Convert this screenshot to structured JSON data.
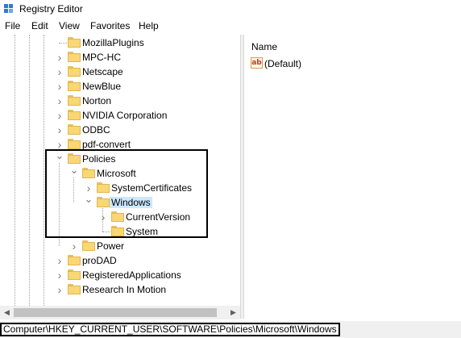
{
  "window": {
    "title": "Registry Editor"
  },
  "menu": [
    "File",
    "Edit",
    "View",
    "Favorites",
    "Help"
  ],
  "tree": {
    "nodes": [
      {
        "label": "MozillaPlugins",
        "expander": "none"
      },
      {
        "label": "MPC-HC",
        "expander": "collapsed"
      },
      {
        "label": "Netscape",
        "expander": "collapsed"
      },
      {
        "label": "NewBlue",
        "expander": "collapsed"
      },
      {
        "label": "Norton",
        "expander": "collapsed"
      },
      {
        "label": "NVIDIA Corporation",
        "expander": "collapsed"
      },
      {
        "label": "ODBC",
        "expander": "collapsed"
      },
      {
        "label": "pdf-convert",
        "expander": "collapsed"
      },
      {
        "label": "Policies",
        "expander": "expanded"
      },
      {
        "label": "Microsoft",
        "expander": "expanded"
      },
      {
        "label": "SystemCertificates",
        "expander": "collapsed"
      },
      {
        "label": "Windows",
        "expander": "expanded",
        "selected": true
      },
      {
        "label": "CurrentVersion",
        "expander": "collapsed"
      },
      {
        "label": "System",
        "expander": "none"
      },
      {
        "label": "Power",
        "expander": "collapsed"
      },
      {
        "label": "proDAD",
        "expander": "collapsed"
      },
      {
        "label": "RegisteredApplications",
        "expander": "collapsed"
      },
      {
        "label": "Research In Motion",
        "expander": "collapsed"
      }
    ]
  },
  "values_pane": {
    "column_header": "Name",
    "rows": [
      {
        "icon": "string-value-icon",
        "icon_text": "ab",
        "name": "(Default)"
      }
    ]
  },
  "statusbar": {
    "path": "Computer\\HKEY_CURRENT_USER\\SOFTWARE\\Policies\\Microsoft\\Windows"
  },
  "icons": {
    "collapsed": "chevron-right-icon",
    "expanded": "chevron-down-icon",
    "folder": "folder-icon"
  },
  "colors": {
    "folder": "#f8d775",
    "selection": "#cce8ff",
    "callout_border": "#000000"
  }
}
